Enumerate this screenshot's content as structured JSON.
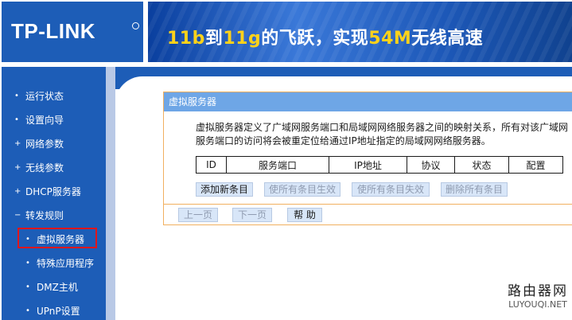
{
  "header": {
    "logo": "TP-LINK",
    "banner": [
      {
        "text": "11b",
        "color": "yellow"
      },
      {
        "text": "到",
        "color": "white"
      },
      {
        "text": "11g",
        "color": "yellow"
      },
      {
        "text": "的飞跃，实现",
        "color": "white"
      },
      {
        "text": "54M",
        "color": "yellow"
      },
      {
        "text": "无线高速",
        "color": "white"
      }
    ]
  },
  "sidebar": {
    "items": [
      {
        "bullet": "•",
        "label": "运行状态"
      },
      {
        "bullet": "•",
        "label": "设置向导"
      },
      {
        "bullet": "+",
        "label": "网络参数"
      },
      {
        "bullet": "+",
        "label": "无线参数"
      },
      {
        "bullet": "+",
        "label": "DHCP服务器"
      },
      {
        "bullet": "−",
        "label": "转发规则"
      },
      {
        "bullet": "•",
        "label": "虚拟服务器"
      },
      {
        "bullet": "•",
        "label": "特殊应用程序"
      },
      {
        "bullet": "•",
        "label": "DMZ主机"
      },
      {
        "bullet": "•",
        "label": "UPnP设置"
      }
    ]
  },
  "panel": {
    "title": "虚拟服务器",
    "desc_line1": "虚拟服务器定义了广域网服务端口和局域网网络服务器之间的映射关系，所有对该广域网",
    "desc_line2": "服务端口的访问将会被重定位给通过IP地址指定的局域网网络服务器。",
    "columns": [
      "ID",
      "服务端口",
      "IP地址",
      "协议",
      "状态",
      "配置"
    ],
    "actions": {
      "add": "添加新条目",
      "enable_all": "使所有条目生效",
      "disable_all": "使所有条目失效",
      "delete_all": "删除所有条目"
    },
    "nav": {
      "prev": "上一页",
      "next": "下一页",
      "help": "帮 助"
    }
  },
  "watermark": {
    "cn": "路由器网",
    "en": "LUYOUQI.NET"
  },
  "colors": {
    "brand_blue": "#1d5db7",
    "panel_header": "#6ea6e6",
    "panel_border": "#f1b060",
    "highlight_red": "#e0161c"
  }
}
